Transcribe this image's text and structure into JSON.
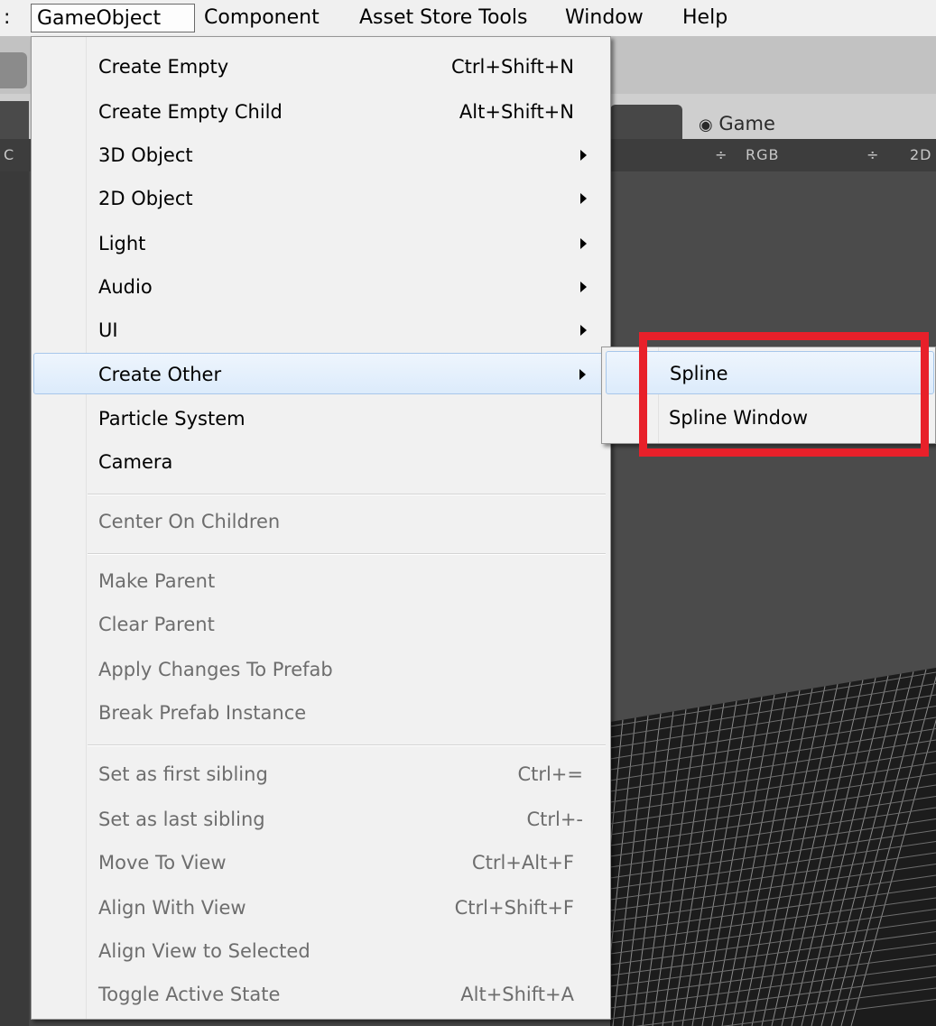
{
  "menubar": {
    "items": [
      {
        "label": ":"
      },
      {
        "label": "GameObject"
      },
      {
        "label": "Component"
      },
      {
        "label": "Asset Store Tools"
      },
      {
        "label": "Window"
      },
      {
        "label": "Help"
      }
    ]
  },
  "background": {
    "game_tab": "Game",
    "left_tab_letter": "C",
    "controls": {
      "rgb": "RGB",
      "mode": "2D",
      "spinner": "÷"
    }
  },
  "menu": {
    "items": [
      {
        "label": "Create Empty",
        "shortcut": "Ctrl+Shift+N"
      },
      {
        "label": "Create Empty Child",
        "shortcut": "Alt+Shift+N"
      },
      {
        "label": "3D Object"
      },
      {
        "label": "2D Object"
      },
      {
        "label": "Light"
      },
      {
        "label": "Audio"
      },
      {
        "label": "UI"
      },
      {
        "label": "Create Other"
      },
      {
        "label": "Particle System"
      },
      {
        "label": "Camera"
      },
      {
        "label": "Center On Children"
      },
      {
        "label": "Make Parent"
      },
      {
        "label": "Clear Parent"
      },
      {
        "label": "Apply Changes To Prefab"
      },
      {
        "label": "Break Prefab Instance"
      },
      {
        "label": "Set as first sibling",
        "shortcut": "Ctrl+="
      },
      {
        "label": "Set as last sibling",
        "shortcut": "Ctrl+-"
      },
      {
        "label": "Move To View",
        "shortcut": "Ctrl+Alt+F"
      },
      {
        "label": "Align With View",
        "shortcut": "Ctrl+Shift+F"
      },
      {
        "label": "Align View to Selected"
      },
      {
        "label": "Toggle Active State",
        "shortcut": "Alt+Shift+A"
      }
    ]
  },
  "submenu": {
    "items": [
      {
        "label": "Spline"
      },
      {
        "label": "Spline Window"
      }
    ]
  },
  "colors": {
    "highlight": "#e8202a",
    "hover_border": "#a7c7eb",
    "disabled_text": "#6d6d6d"
  }
}
